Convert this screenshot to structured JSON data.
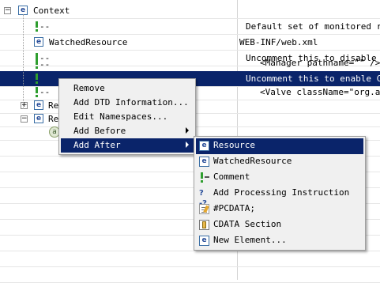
{
  "tree": {
    "rows": [
      {
        "name": "Context",
        "value": ""
      },
      {
        "name": "--",
        "value": "Default set of monitored reso"
      },
      {
        "name": "WatchedResource",
        "value": "WEB-INF/web.xml"
      },
      {
        "name": "--",
        "value": "Uncomment this to disable ses"
      },
      {
        "name": "--",
        "value": "<Manager pathname=\"\" />"
      },
      {
        "name": "--",
        "value": "Uncomment this to enable Come"
      },
      {
        "name": "--",
        "value": "<Valve className=\"org.apac"
      },
      {
        "name": "Re",
        "value": ""
      },
      {
        "name": "Re",
        "value": ""
      },
      {
        "name": "@",
        "value": ""
      }
    ],
    "expander_minus": "−",
    "expander_plus": "+",
    "element_glyph": "e",
    "attr_glyph": "a"
  },
  "context_menu": {
    "items": [
      {
        "label": "Remove"
      },
      {
        "label": "Add DTD Information..."
      },
      {
        "label": "Edit Namespaces..."
      },
      {
        "label": "Add Before"
      },
      {
        "label": "Add After"
      }
    ]
  },
  "submenu": {
    "items": [
      {
        "label": "Resource",
        "icon": "element-icon"
      },
      {
        "label": "WatchedResource",
        "icon": "element-icon"
      },
      {
        "label": "Comment",
        "icon": "comment-icon"
      },
      {
        "label": "Add Processing Instruction",
        "icon": "processing-instruction-icon"
      },
      {
        "label": "#PCDATA;",
        "icon": "pcdata-icon"
      },
      {
        "label": "CDATA Section",
        "icon": "cdata-icon"
      },
      {
        "label": "New Element...",
        "icon": "element-icon"
      }
    ]
  },
  "colors": {
    "selection": "#0a246a",
    "menu_bg": "#f0f0f0",
    "comment_green": "#2f9e2f"
  }
}
